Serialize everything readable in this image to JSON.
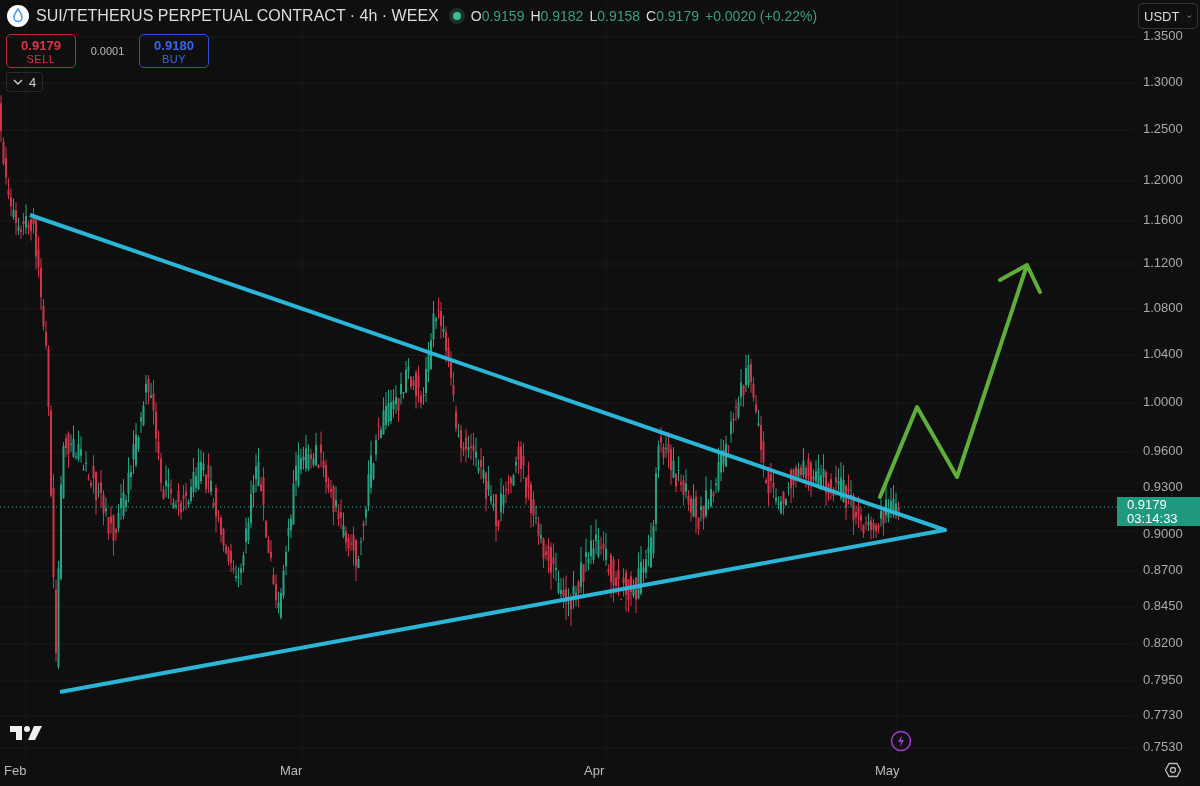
{
  "header": {
    "symbol": "SUI/TETHERUS PERPETUAL CONTRACT · 4h · WEEX",
    "ohlc": [
      {
        "label": "O",
        "value": "0.9159"
      },
      {
        "label": "H",
        "value": "0.9182"
      },
      {
        "label": "L",
        "value": "0.9158"
      },
      {
        "label": "C",
        "value": "0.9179"
      }
    ],
    "change": "+0.0020 (+0.22%)"
  },
  "trade": {
    "sell": {
      "price": "0.9179",
      "label": "SELL"
    },
    "spread": "0.0001",
    "buy": {
      "price": "0.9180",
      "label": "BUY"
    }
  },
  "indicators": {
    "count": "4"
  },
  "currency": "USDT",
  "price_axis": {
    "ticks": [
      "1.3500",
      "1.3000",
      "1.2500",
      "1.2000",
      "1.1600",
      "1.1200",
      "1.0800",
      "1.0400",
      "1.0000",
      "0.9600",
      "0.9300",
      "0.9000",
      "0.8700",
      "0.8450",
      "0.8200",
      "0.7950",
      "0.7730",
      "0.7530"
    ],
    "last_price": "0.9179",
    "countdown": "03:14:33"
  },
  "time_axis": {
    "labels": [
      "Feb",
      "Mar",
      "Apr",
      "May"
    ]
  }
}
